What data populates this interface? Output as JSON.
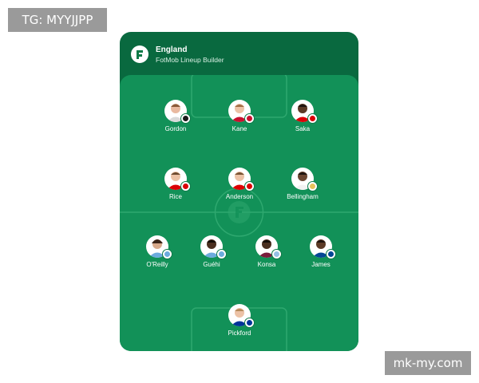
{
  "watermarks": {
    "top_left": "TG: MYYJJPP",
    "bottom_right": "mk-my.com"
  },
  "header": {
    "team": "England",
    "subtitle": "FotMob Lineup Builder",
    "logo_icon": "fotmob-logo-icon"
  },
  "colors": {
    "header_bg": "#09693f",
    "pitch_bg": "#129158",
    "line": "#2ea86f"
  },
  "lineup": {
    "forwards": [
      {
        "name": "Gordon",
        "club_badge": "#1a1a1a"
      },
      {
        "name": "Kane",
        "club_badge": "#c8102e"
      },
      {
        "name": "Saka",
        "club_badge": "#db0007"
      }
    ],
    "midfielders": [
      {
        "name": "Rice",
        "club_badge": "#db0007"
      },
      {
        "name": "Anderson",
        "club_badge": "#dd0000"
      },
      {
        "name": "Bellingham",
        "club_badge": "#e6c35c"
      }
    ],
    "defenders": [
      {
        "name": "O'Reilly",
        "club_badge": "#6cabdd"
      },
      {
        "name": "Guéhi",
        "club_badge": "#6cabdd"
      },
      {
        "name": "Konsa",
        "club_badge": "#95bfe5"
      },
      {
        "name": "James",
        "club_badge": "#034694"
      }
    ],
    "goalkeeper": [
      {
        "name": "Pickford",
        "club_badge": "#003399"
      }
    ]
  }
}
